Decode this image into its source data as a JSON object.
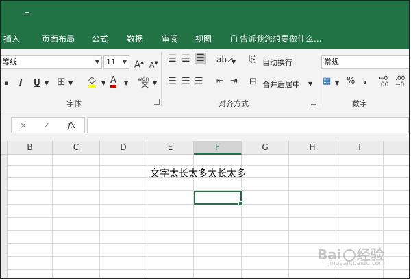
{
  "qat": {
    "customize_glyph": "="
  },
  "tabs": [
    {
      "label": "插入"
    },
    {
      "label": "页面布局"
    },
    {
      "label": "公式"
    },
    {
      "label": "数据"
    },
    {
      "label": "审阅"
    },
    {
      "label": "视图"
    }
  ],
  "tell_me": {
    "placeholder": "告诉我您想要做什么..."
  },
  "font_group": {
    "font_name": "等线",
    "font_size": "11",
    "grow_font": "A",
    "shrink_font": "A",
    "italic": "I",
    "underline": "U",
    "font_color_letter": "A",
    "phonetic": "wén",
    "label": "字体"
  },
  "align_group": {
    "wrap_text": "自动换行",
    "merge_center": "合并后居中",
    "label": "对齐方式"
  },
  "number_group": {
    "format": "常规",
    "percent": "%",
    "comma": ",",
    "label": "数字"
  },
  "formula_bar": {
    "fx": "fx",
    "cancel": "×",
    "enter": "✓"
  },
  "columns": [
    "B",
    "C",
    "D",
    "E",
    "F",
    "G",
    "H",
    "I"
  ],
  "active_column": "F",
  "sheet": {
    "cell_text": "文字太长太多太长太多"
  },
  "watermark": {
    "brand": "Bai",
    "brand_after": "经验",
    "sub": "jingyan.baidu.com"
  },
  "colors": {
    "excel_green": "#217346"
  }
}
